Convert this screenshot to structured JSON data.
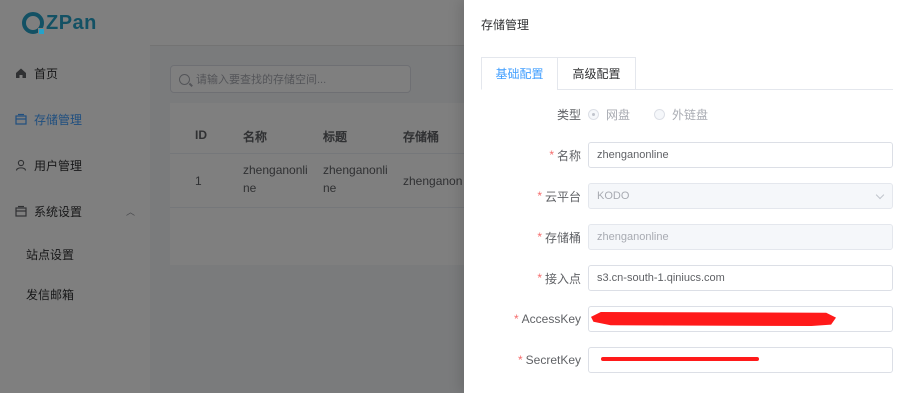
{
  "brand": {
    "logo_text": "ZPan",
    "accent": "#27a2c9"
  },
  "sidebar": {
    "items": [
      {
        "label": "首页",
        "icon": "home-icon"
      },
      {
        "label": "存储管理",
        "icon": "storage-icon",
        "active": true
      },
      {
        "label": "用户管理",
        "icon": "user-icon"
      },
      {
        "label": "系统设置",
        "icon": "settings-icon",
        "expanded": true
      }
    ],
    "sub_items": [
      {
        "label": "站点设置"
      },
      {
        "label": "发信邮箱"
      }
    ]
  },
  "main": {
    "search_placeholder": "请输入要查找的存储空间...",
    "table": {
      "headers": [
        "ID",
        "名称",
        "标题",
        "存储桶"
      ],
      "rows": [
        {
          "id": "1",
          "name": "zhenganonline",
          "title": "zhenganonline",
          "bucket": "zhenganon"
        }
      ]
    }
  },
  "drawer": {
    "title": "存储管理",
    "tabs": [
      {
        "label": "基础配置",
        "active": true
      },
      {
        "label": "高级配置"
      }
    ],
    "form": {
      "type": {
        "label": "类型",
        "options": [
          {
            "label": "网盘",
            "checked": true
          },
          {
            "label": "外链盘",
            "checked": false
          }
        ]
      },
      "name": {
        "label": "名称",
        "required": true,
        "value": "zhenganonline"
      },
      "cloud": {
        "label": "云平台",
        "required": true,
        "value": "KODO"
      },
      "bucket": {
        "label": "存储桶",
        "required": true,
        "value": "zhenganonline"
      },
      "endpoint": {
        "label": "接入点",
        "required": true,
        "value": "s3.cn-south-1.qiniucs.com"
      },
      "access_key": {
        "label": "AccessKey",
        "required": true,
        "value": ""
      },
      "secret_key": {
        "label": "SecretKey",
        "required": true,
        "value": ""
      }
    },
    "colors": {
      "primary": "#409eff",
      "required": "#f56c6c",
      "redaction": "#ff1a1a"
    }
  }
}
